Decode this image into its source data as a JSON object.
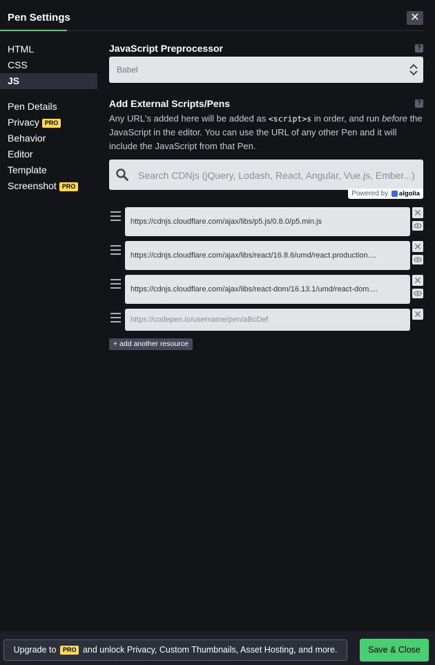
{
  "header": {
    "title": "Pen Settings",
    "close_label": "✕"
  },
  "sidebar": {
    "group1": [
      {
        "label": "HTML"
      },
      {
        "label": "CSS"
      },
      {
        "label": "JS",
        "active": true
      }
    ],
    "group2": [
      {
        "label": "Pen Details"
      },
      {
        "label": "Privacy",
        "badge": "PRO"
      },
      {
        "label": "Behavior"
      },
      {
        "label": "Editor"
      },
      {
        "label": "Template"
      },
      {
        "label": "Screenshot",
        "badge": "PRO"
      }
    ]
  },
  "preprocessor": {
    "title": "JavaScript Preprocessor",
    "help": "?",
    "selected": "Babel"
  },
  "external": {
    "title": "Add External Scripts/Pens",
    "help": "?",
    "desc_1": "Any URL's added here will be added as ",
    "desc_code": "<script>s",
    "desc_2": " in order, and run ",
    "desc_em": "before",
    "desc_3": " the JavaScript in the editor. You can use the URL of any other Pen and it will include the JavaScript from that Pen.",
    "search_placeholder": "Search CDNjs (jQuery, Lodash, React, Angular, Vue.js, Ember...)",
    "powered_by": "Powered by",
    "algolia": "algolia",
    "resources": [
      "https://cdnjs.cloudflare.com/ajax/libs/p5.js/0.8.0/p5.min.js",
      "https://cdnjs.cloudflare.com/ajax/libs/react/16.8.6/umd/react.production....",
      "https://cdnjs.cloudflare.com/ajax/libs/react-dom/16.13.1/umd/react-dom...."
    ],
    "new_resource_placeholder": "https://codepen.io/username/pen/aBcDef",
    "remove_label": "✕",
    "add_label": "+ add another resource"
  },
  "footer": {
    "upgrade_pre": "Upgrade to",
    "upgrade_badge": "PRO",
    "upgrade_post": "and unlock Privacy, Custom Thumbnails, Asset Hosting, and more.",
    "save_label": "Save & Close"
  },
  "colors": {
    "accent": "#47cf73",
    "pro": "#ffdd40",
    "bg": "#131417"
  }
}
